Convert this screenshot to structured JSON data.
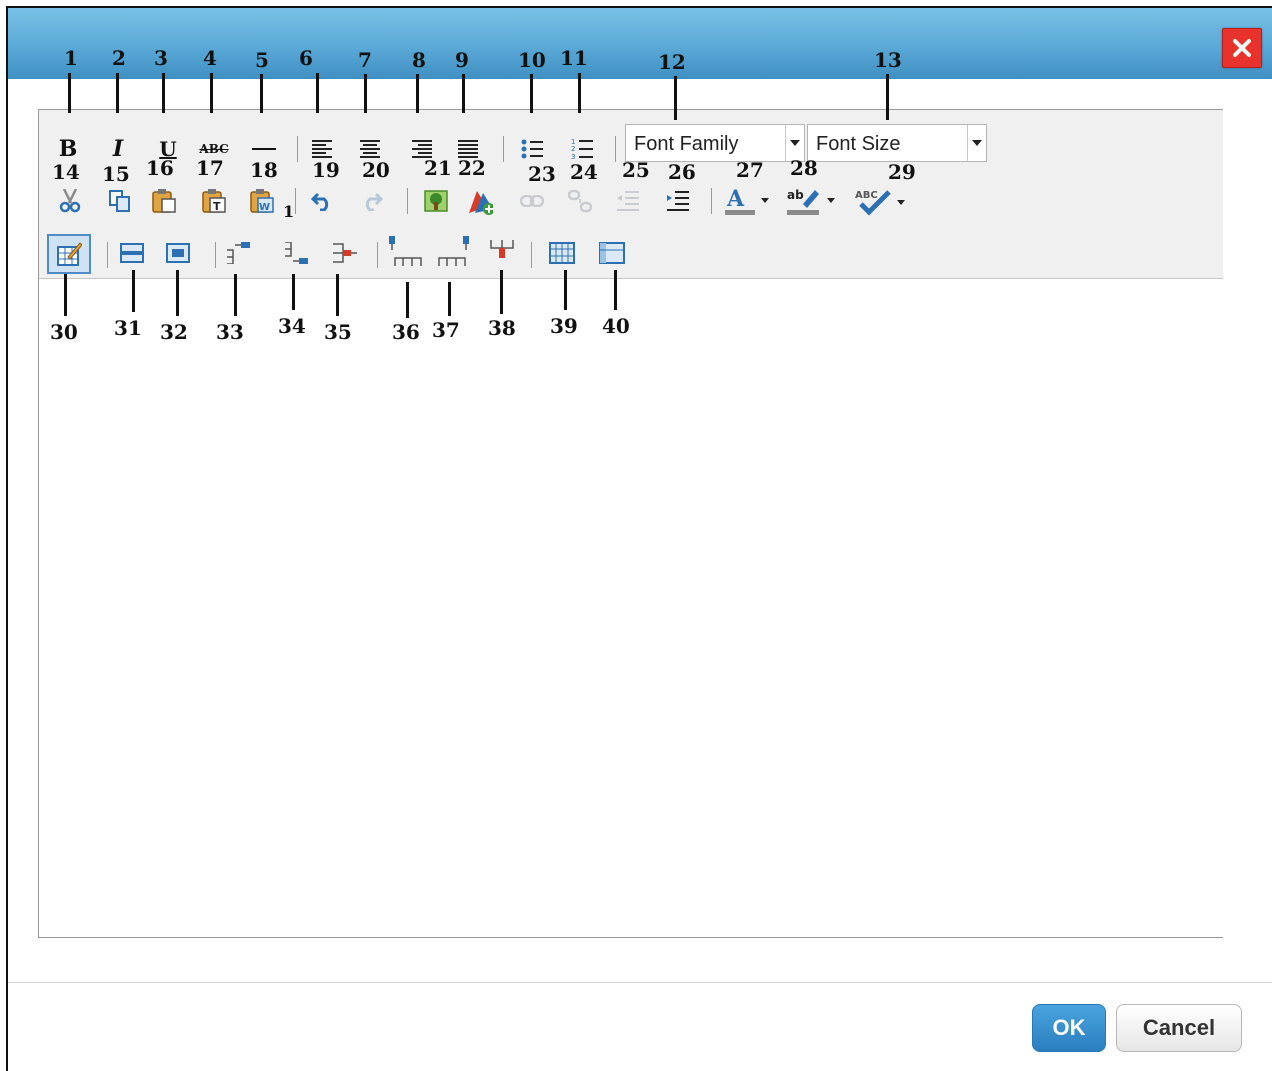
{
  "dialog": {
    "close_icon": "close-icon",
    "buttons": {
      "ok": "OK",
      "cancel": "Cancel"
    }
  },
  "toolbar": {
    "font_family": "Font Family",
    "font_size": "Font Size",
    "icons": [
      "bold-icon",
      "italic-icon",
      "underline-icon",
      "strikethrough-icon",
      "horizontal-rule-icon",
      "align-left-icon",
      "align-center-icon",
      "align-right-icon",
      "align-justify-icon",
      "bullet-list-icon",
      "numbered-list-icon",
      "cut-icon",
      "copy-icon",
      "paste-icon",
      "paste-text-icon",
      "paste-word-icon",
      "undo-icon",
      "redo-icon",
      "insert-image-icon",
      "insert-media-icon",
      "link-icon",
      "unlink-icon",
      "outdent-icon",
      "indent-icon",
      "font-color-icon",
      "highlight-color-icon",
      "spellcheck-icon",
      "table-properties-icon",
      "row-above-icon",
      "row-below-icon",
      "column-before-icon",
      "column-after-icon",
      "delete-column-icon",
      "insert-row-before-icon",
      "insert-row-after-icon",
      "delete-row-icon",
      "merge-cells-icon",
      "split-cell-icon"
    ]
  },
  "callouts": {
    "n1": "1",
    "n2": "2",
    "n3": "3",
    "n4": "4",
    "n5": "5",
    "n6": "6",
    "n7": "7",
    "n8": "8",
    "n9": "9",
    "n10": "10",
    "n11": "11",
    "n12": "12",
    "n13": "13",
    "n14": "14",
    "n15": "15",
    "n16": "16",
    "n17": "17",
    "n18": "18",
    "n19": "19",
    "n20": "20",
    "n21": "21",
    "n22": "22",
    "n23": "23",
    "n24": "24",
    "n25": "25",
    "n26": "26",
    "n27": "27",
    "n28": "28",
    "n29": "29",
    "n30": "30",
    "n31": "31",
    "n32": "32",
    "n33": "33",
    "n34": "34",
    "n35": "35",
    "n36": "36",
    "n37": "37",
    "n38": "38",
    "n39": "39",
    "n40": "40",
    "paste_word_sub": "1"
  }
}
